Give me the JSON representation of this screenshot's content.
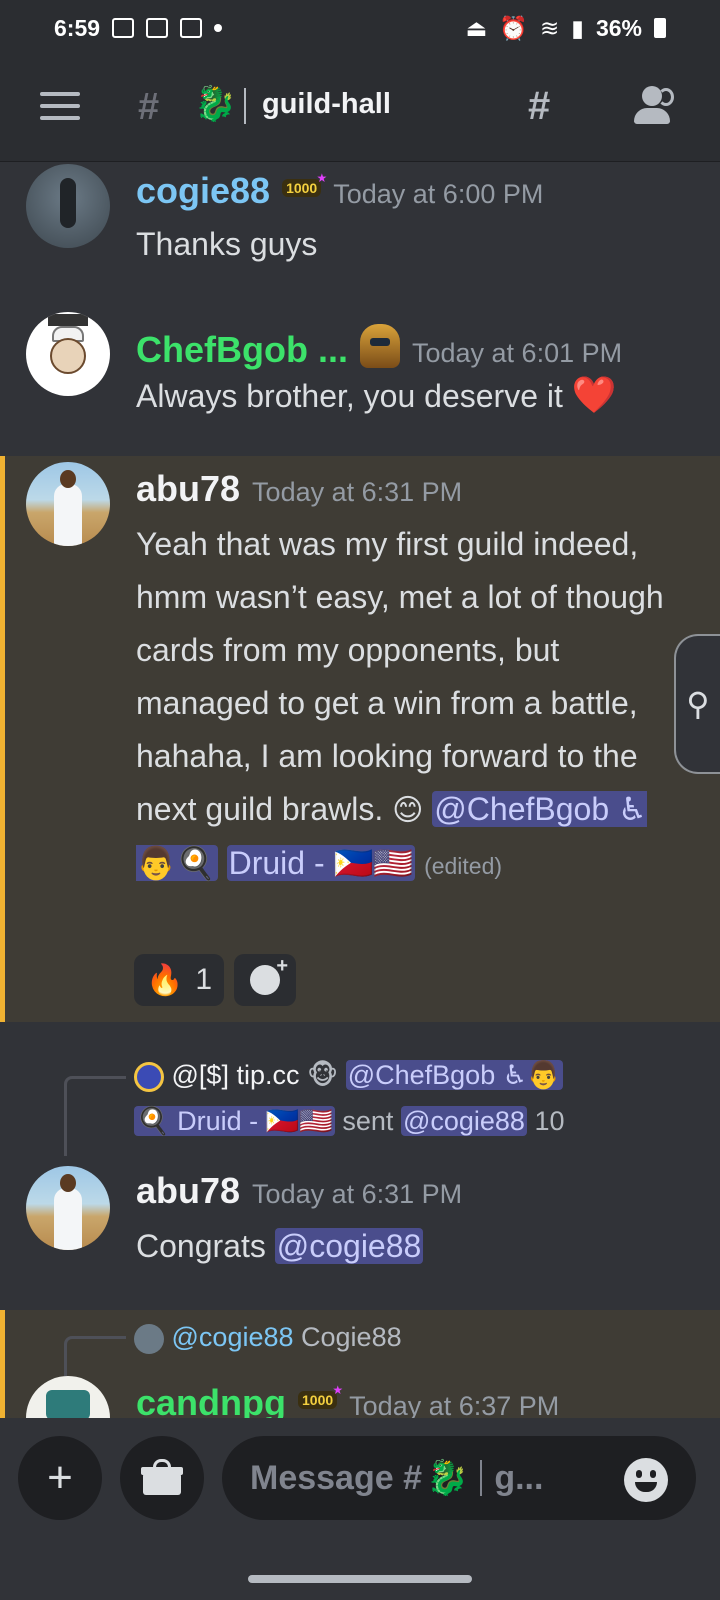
{
  "status_bar": {
    "time": "6:59",
    "battery": "36%",
    "left_icons": [
      "gallery-icon",
      "mail-icon",
      "close-box-icon",
      "dot-icon"
    ],
    "right_icons": [
      "alarm-lock-icon",
      "alarm-icon",
      "wifi-icon",
      "signal-icon",
      "battery-icon"
    ]
  },
  "header": {
    "channel_emoji": "🐉",
    "channel_name": "guild-hall",
    "icons": [
      "menu-icon",
      "locked-hash-icon",
      "threads-icon",
      "members-icon"
    ]
  },
  "messages": [
    {
      "username": "cogie88",
      "badge": "1000",
      "timestamp": "Today at 6:00 PM",
      "text": "Thanks guys"
    },
    {
      "username": "ChefBgob ...",
      "timestamp": "Today at 6:01 PM",
      "text": "Always brother, you deserve it",
      "trailing_emoji": "❤️"
    },
    {
      "username": "abu78",
      "timestamp": "Today at 6:31 PM",
      "text": "Yeah that was my first guild indeed, hmm wasn’t easy, met a lot of though cards from my opponents, but managed to get a win from a battle, hahaha, I am looking forward to the next guild brawls.",
      "emoji": "😊",
      "mention": "@ChefBgob ♿👨🍳 Druid - 🇵🇭🇺🇸",
      "mention_line1": "@ChefBgob ♿👨🍳",
      "mention_line2": "Druid - 🇵🇭🇺🇸",
      "edited": "(edited)",
      "reactions": [
        {
          "emoji": "🔥",
          "count": "1"
        }
      ]
    },
    {
      "reply": {
        "author": "@[$] tip.cc",
        "badge_emoji": "🐵",
        "mention_1a": "@ChefBgob ♿👨",
        "mention_1b": "🍳 Druid - 🇵🇭🇺🇸",
        "verb": "sent",
        "mention_2": "@cogie88",
        "amount": "10"
      },
      "username": "abu78",
      "timestamp": "Today at 6:31 PM",
      "text": "Congrats",
      "mention": "@cogie88"
    },
    {
      "reply": {
        "mention": "@cogie88",
        "text": "Cogie88"
      },
      "username": "candnpg",
      "badge": "1000",
      "timestamp": "Today at 6:37 PM"
    }
  ],
  "composer": {
    "placeholder_prefix": "Message #",
    "channel_emoji": "🐉",
    "placeholder_suffix": "g...",
    "plus_label": "+"
  },
  "colors": {
    "background": "#313338",
    "highlight_bg": "#3f3c35",
    "highlight_bar": "#f0b232",
    "mention_bg": "#4a4d8c",
    "cogie_name": "#7cc6f4",
    "chef_name": "#3ce26a"
  }
}
